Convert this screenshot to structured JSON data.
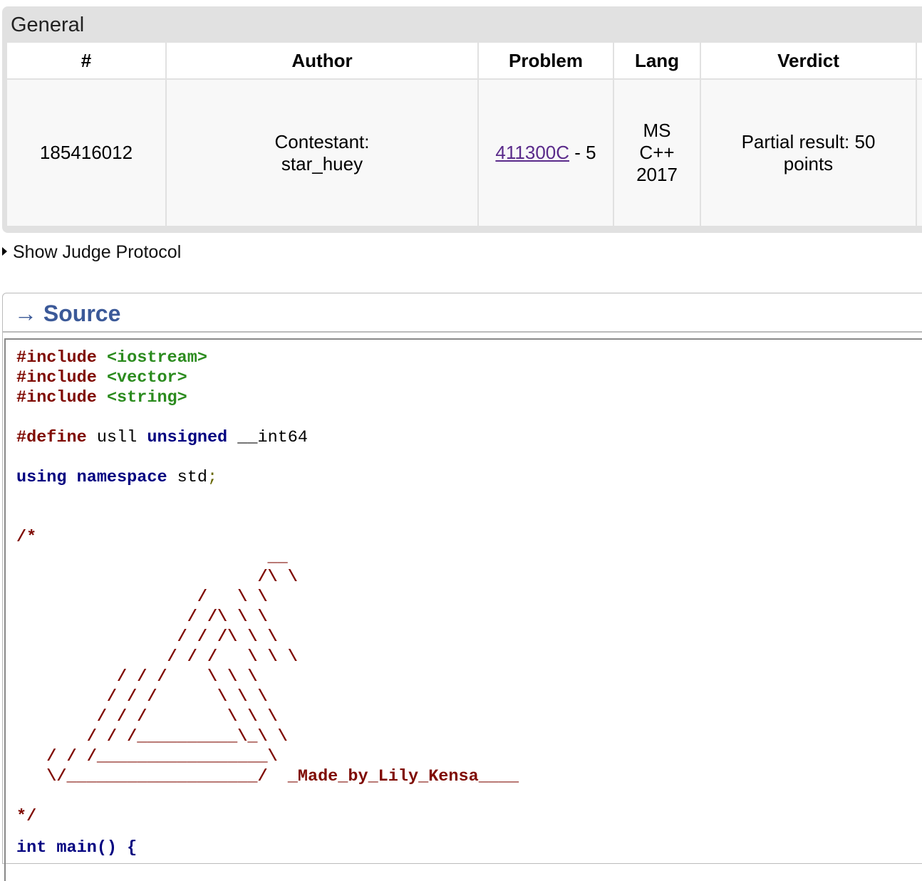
{
  "general": {
    "title": "General",
    "headers": [
      "#",
      "Author",
      "Problem",
      "Lang",
      "Verdict"
    ],
    "row": {
      "id": "185416012",
      "author_line1": "Contestant:",
      "author_line2": "star_huey",
      "problem_link": "411300C",
      "problem_suffix": " - 5",
      "lang_line1": "MS",
      "lang_line2": "C++",
      "lang_line3": "2017",
      "verdict_line1": "Partial result: 50",
      "verdict_line2": "points"
    }
  },
  "judge_protocol": {
    "label": "Show Judge Protocol"
  },
  "source": {
    "title": "→ Source",
    "code": {
      "l1_kw": "#include",
      "l1_str": "<iostream>",
      "l2_kw": "#include",
      "l2_str": "<vector>",
      "l3_kw": "#include",
      "l3_str": "<string>",
      "l4_kw": "#define",
      "l4_a": " usll ",
      "l4_kw2": "unsigned",
      "l4_b": " __int64",
      "l5_kw2a": "using",
      "l5_kw2b": "namespace",
      "l5_a": " std",
      "l5_punc": ";",
      "c_open": "/*",
      "art": [
        "                         __",
        "                        /\\ \\",
        "                  /   \\ \\",
        "                 / /\\ \\ \\",
        "                / / /\\ \\ \\",
        "               / / /   \\ \\ \\",
        "          / / /    \\ \\ \\",
        "         / / /      \\ \\ \\",
        "        / / /        \\ \\ \\",
        "       / / /__________\\_\\ \\",
        "   / / /_________________\\",
        "   \\/___________________/  _Made_by_Lily_Kensa____"
      ],
      "c_close": "*/",
      "last": "int main() {"
    }
  }
}
